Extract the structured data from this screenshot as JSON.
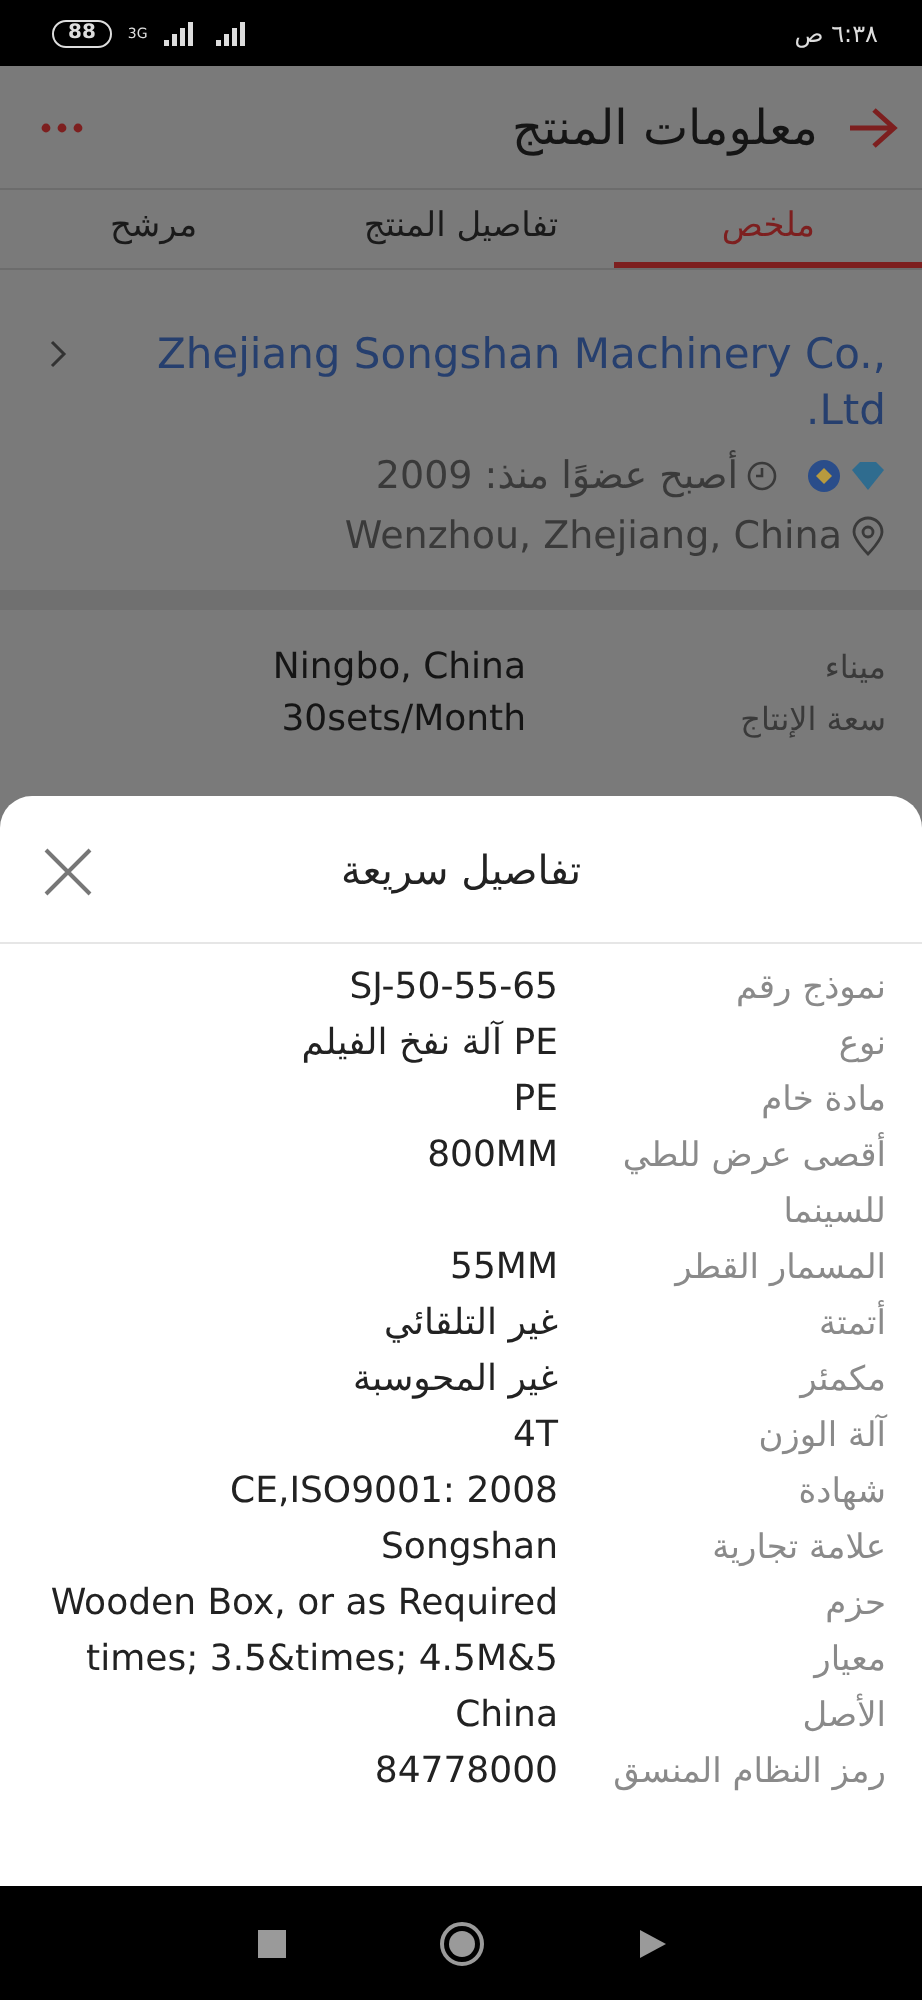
{
  "status_bar": {
    "time": "٦:٣٨ ص",
    "battery": "88",
    "network": "3G"
  },
  "header": {
    "title": "معلومات المنتج"
  },
  "tabs": [
    {
      "label": "ملخص",
      "selected": true
    },
    {
      "label": "تفاصيل المنتج",
      "selected": false
    },
    {
      "label": "مرشح",
      "selected": false
    }
  ],
  "company": {
    "name": "Zhejiang Songshan Machinery Co., .Ltd",
    "member_since": "أصبح عضوًا منذ: 2009",
    "location": "Wenzhou, Zhejiang, China"
  },
  "specs": [
    {
      "label": "ميناء",
      "value": "Ningbo, China"
    },
    {
      "label": "سعة الإنتاج",
      "value": "30sets/Month"
    }
  ],
  "quick_details": {
    "title": "تفاصيل سريعة",
    "rows": [
      {
        "label": "نموذج رقم",
        "value": "SJ-50-55-65"
      },
      {
        "label": "نوع",
        "value": "PE آلة نفخ الفيلم"
      },
      {
        "label": "مادة خام",
        "value": "PE"
      },
      {
        "label": "أقصى عرض للطي للسينما",
        "value": "800MM"
      },
      {
        "label": "المسمار القطر",
        "value": "55MM"
      },
      {
        "label": "أتمتة",
        "value": "غير التلقائي"
      },
      {
        "label": "مكمئر",
        "value": "غير المحوسبة"
      },
      {
        "label": "آلة الوزن",
        "value": "4T"
      },
      {
        "label": "شهادة",
        "value": "CE,ISO9001: 2008"
      },
      {
        "label": "علامة تجارية",
        "value": "Songshan"
      },
      {
        "label": "حزم",
        "value": "Wooden Box, or as Required"
      },
      {
        "label": "معيار",
        "value": "times; 3.5&times; 4.5M&5"
      },
      {
        "label": "الأصل",
        "value": "China"
      },
      {
        "label": "رمز النظام المنسق",
        "value": "84778000"
      }
    ]
  }
}
